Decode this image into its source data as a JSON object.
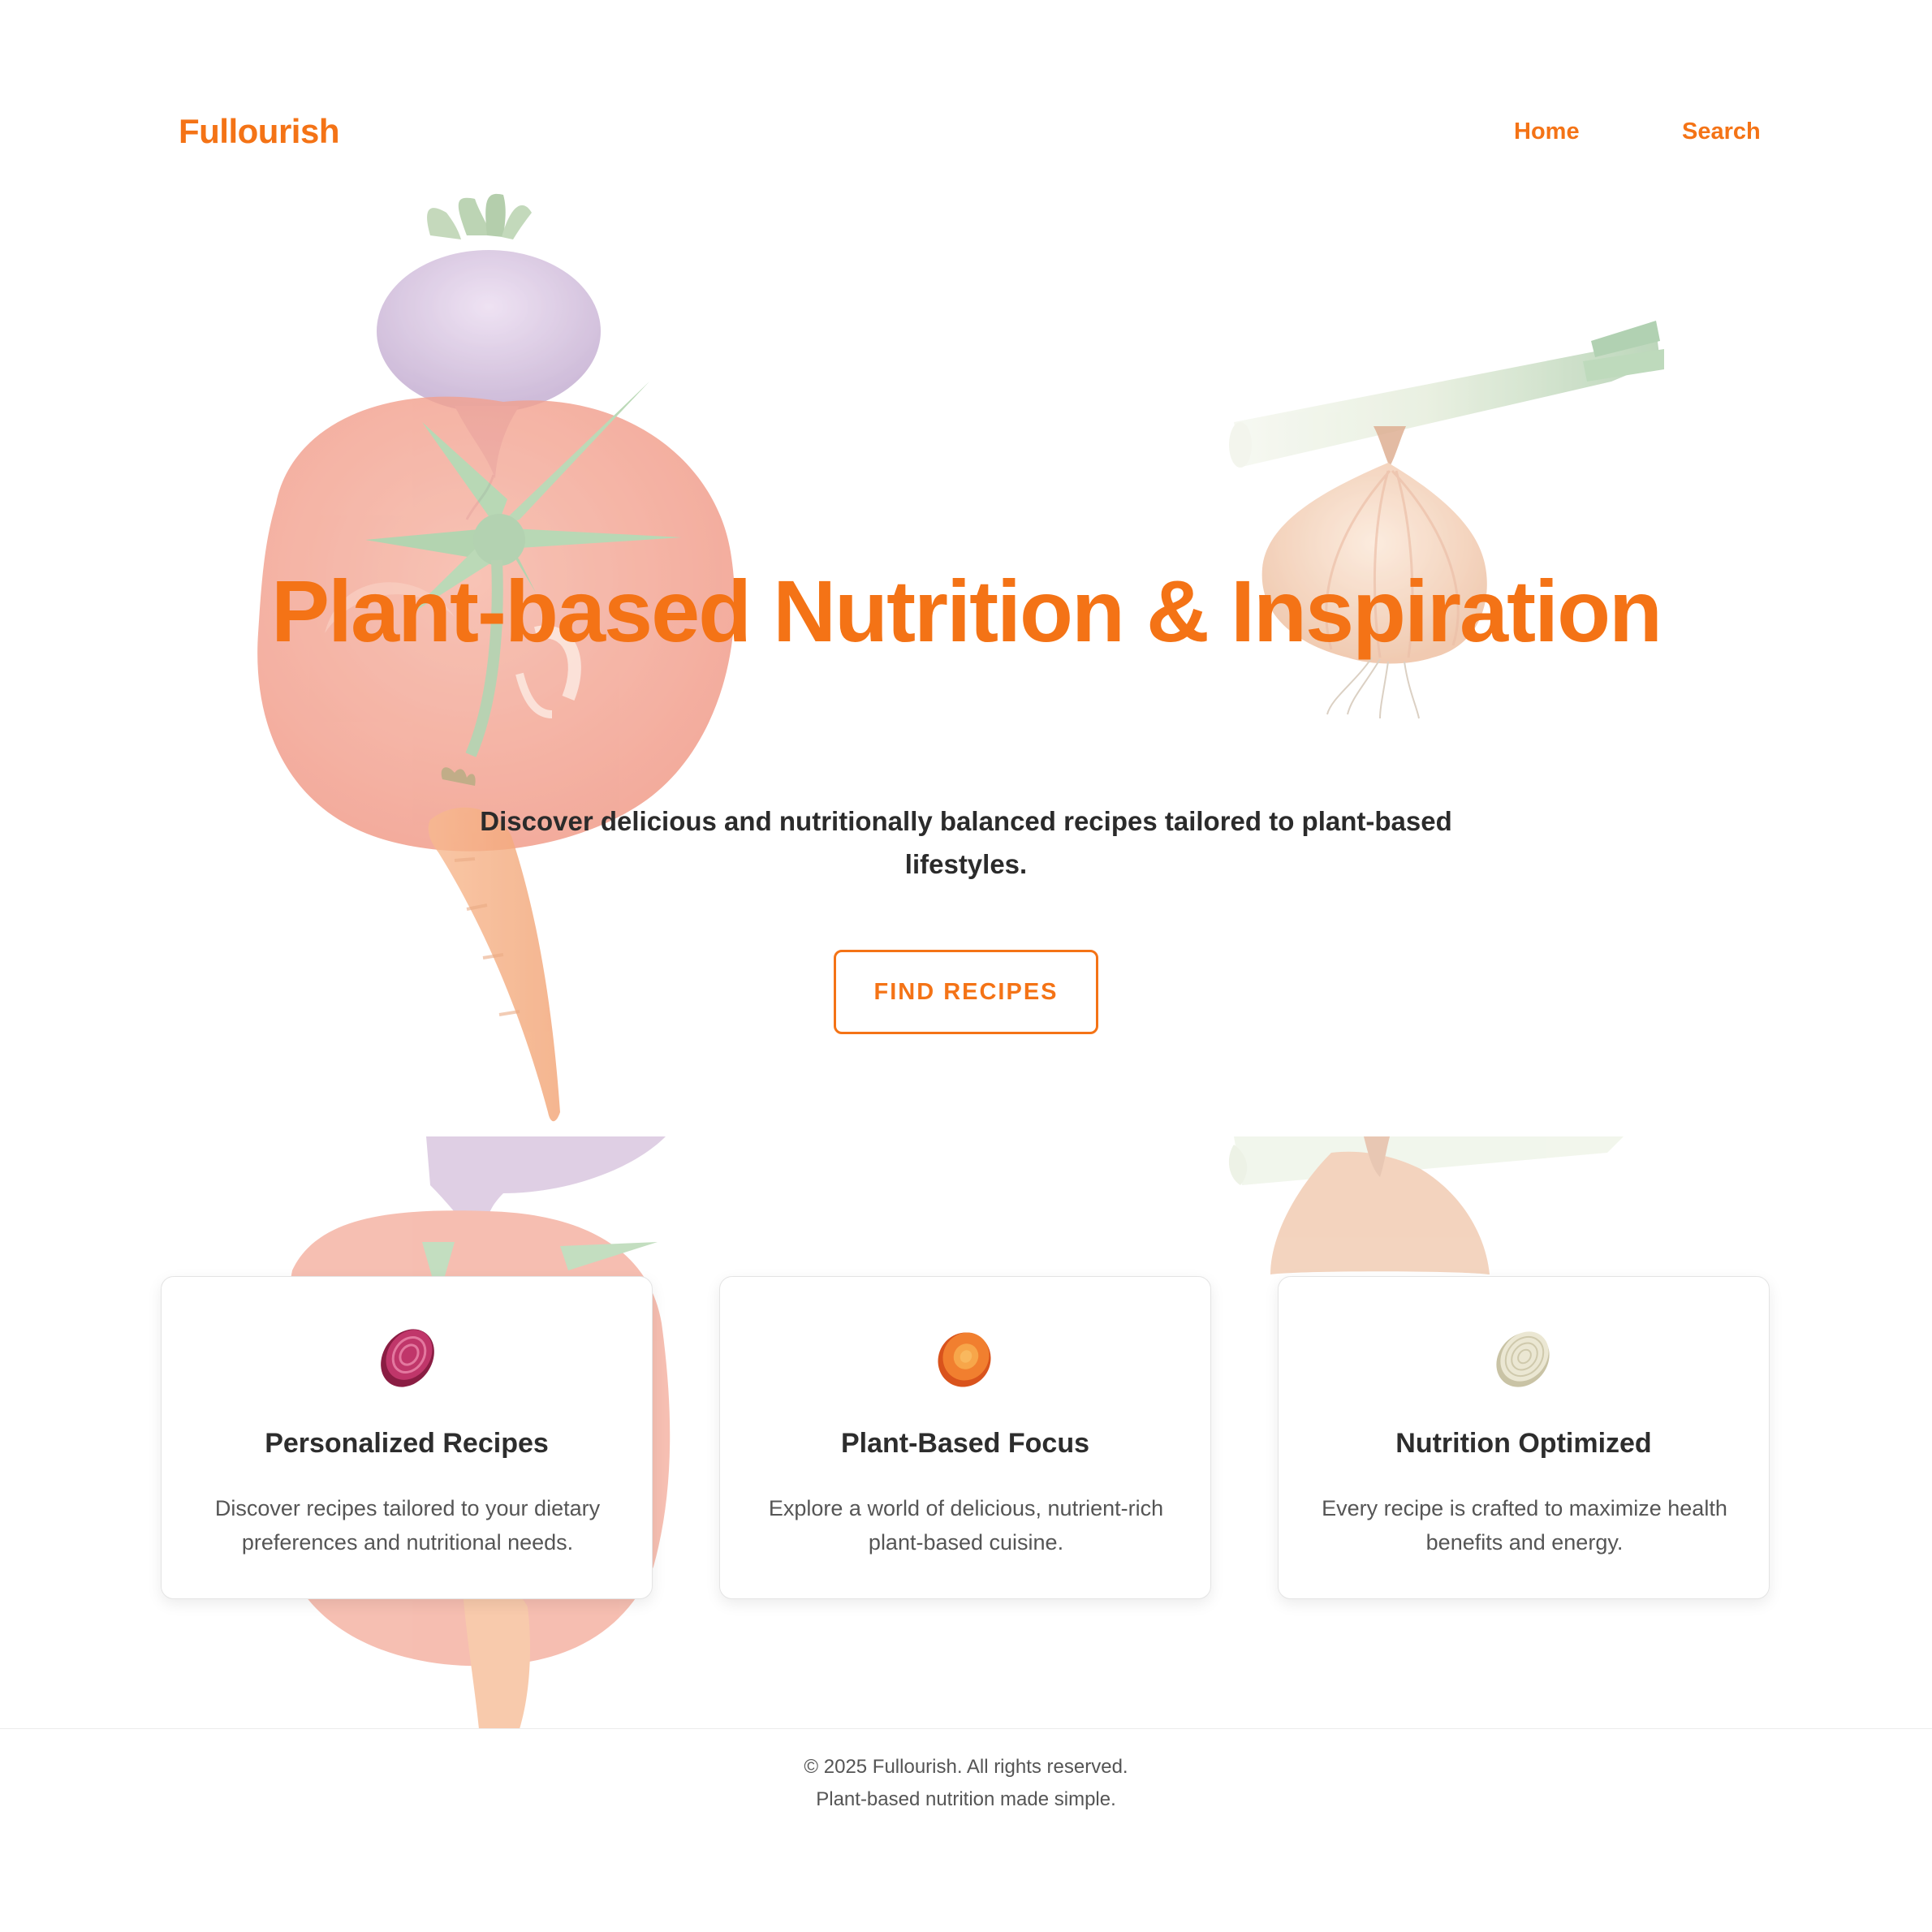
{
  "nav": {
    "brand": "Fullourish",
    "links": [
      {
        "label": "Home"
      },
      {
        "label": "Search"
      }
    ]
  },
  "hero": {
    "title": "Plant-based Nutrition & Inspiration",
    "subtitle": "Discover delicious and nutritionally balanced recipes tailored to plant-based lifestyles.",
    "cta_label": "FIND RECIPES",
    "illustrations": [
      "turnip",
      "tomato",
      "carrot",
      "leek",
      "onion"
    ]
  },
  "features": [
    {
      "icon": "beet-slice-icon",
      "title": "Personalized Recipes",
      "text": "Discover recipes tailored to your dietary preferences and nutritional needs."
    },
    {
      "icon": "carrot-slice-icon",
      "title": "Plant-Based Focus",
      "text": "Explore a world of delicious, nutrient-rich plant-based cuisine."
    },
    {
      "icon": "onion-slice-icon",
      "title": "Nutrition Optimized",
      "text": "Every recipe is crafted to maximize health benefits and energy."
    }
  ],
  "footer": {
    "copyright": "© 2025 Fullourish. All rights reserved.",
    "tagline": "Plant-based nutrition made simple."
  },
  "colors": {
    "accent": "#f47316",
    "text_dark": "#2b2b2b",
    "text_muted": "#555555"
  }
}
